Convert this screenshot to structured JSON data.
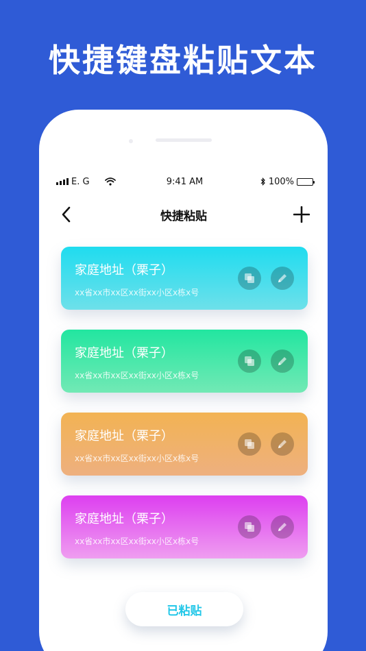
{
  "headline": "快捷键盘粘贴文本",
  "status_bar": {
    "carrier": "E. G",
    "time": "9:41 AM",
    "battery": "100%"
  },
  "nav": {
    "title": "快捷粘贴",
    "back_icon": "chevron-left-icon",
    "add_icon": "plus-icon"
  },
  "cards": [
    {
      "title": "家庭地址（栗子）",
      "subtitle": "xx省xx市xx区xx街xx小区x栋x号",
      "color_top": "#1fdcef",
      "color_bottom": "#6ee0ea"
    },
    {
      "title": "家庭地址（栗子）",
      "subtitle": "xx省xx市xx区xx街xx小区x栋x号",
      "color_top": "#22e6a0",
      "color_bottom": "#72e9b5"
    },
    {
      "title": "家庭地址（栗子）",
      "subtitle": "xx省xx市xx区xx街xx小区x栋x号",
      "color_top": "#f2b353",
      "color_bottom": "#eeb07f"
    },
    {
      "title": "家庭地址（栗子）",
      "subtitle": "xx省xx市xx区xx街xx小区x栋x号",
      "color_top": "#dd3ff0",
      "color_bottom": "#ef9ef0"
    }
  ],
  "card_icons": {
    "copy": "copy-icon",
    "edit": "pencil-icon"
  },
  "pasted_button": "已粘贴"
}
